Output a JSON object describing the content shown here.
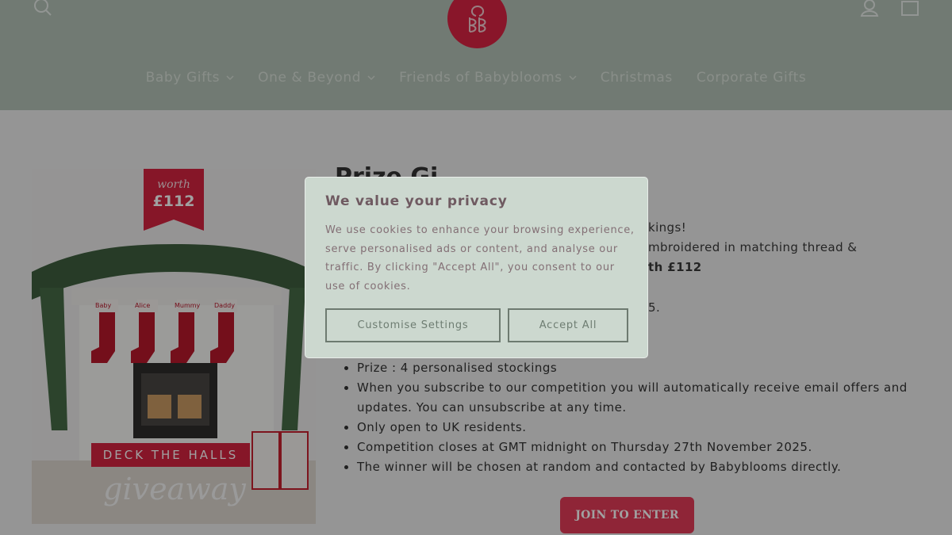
{
  "header": {
    "nav": [
      {
        "label": "Baby Gifts",
        "has_dropdown": true
      },
      {
        "label": "One & Beyond",
        "has_dropdown": true
      },
      {
        "label": "Friends of Babyblooms",
        "has_dropdown": true
      },
      {
        "label": "Christmas",
        "has_dropdown": false
      },
      {
        "label": "Corporate Gifts",
        "has_dropdown": false
      }
    ],
    "icons": [
      "search-icon",
      "babyblooms-logo",
      "account-icon",
      "cart-icon"
    ]
  },
  "hero": {
    "worth_top": "worth",
    "worth_value": "£112",
    "stocking_names": [
      "Baby",
      "Alice",
      "Mummy",
      "Daddy"
    ],
    "banner": "DECK THE HALLS",
    "script_text": "giveaway"
  },
  "content": {
    "title_partial": "Prize Gi",
    "peek_lines": [
      "kings!",
      "mbroidered in matching thread &",
      "th £112",
      "5."
    ],
    "bullets": [
      "Prize : 4 personalised stockings",
      "When you subscribe to our competition you will automatically receive email offers and updates. You can unsubscribe at any time.",
      "Only open to UK residents.",
      "Competition closes at GMT midnight on Thursday 27th November 2025.",
      "The winner will be chosen at random and contacted by Babyblooms directly."
    ],
    "cta": "JOIN TO ENTER"
  },
  "cookie": {
    "title": "We value your privacy",
    "body": "We use cookies to enhance your browsing experience, serve personalised ads or content, and analyse our traffic. By clicking \"Accept All\", you consent to our use of cookies.",
    "customise": "Customise Settings",
    "accept": "Accept All"
  },
  "colors": {
    "header_bg": "#b4c2b6",
    "brand_red": "#d92443",
    "cta_bg": "#e23c57",
    "dialog_bg": "#ccd8cf"
  }
}
